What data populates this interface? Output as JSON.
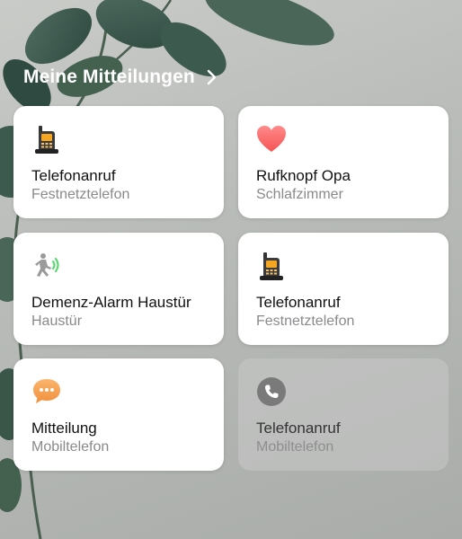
{
  "header": {
    "title": "Meine Mitteilungen"
  },
  "cards": [
    {
      "title": "Telefonanruf",
      "subtitle": "Festnetztelefon",
      "icon": "landline-phone-icon"
    },
    {
      "title": "Rufknopf Opa",
      "subtitle": "Schlafzimmer",
      "icon": "heart-icon"
    },
    {
      "title": "Demenz-Alarm Haustür",
      "subtitle": "Haustür",
      "icon": "running-person-alarm-icon"
    },
    {
      "title": "Telefonanruf",
      "subtitle": "Festnetztelefon",
      "icon": "landline-phone-icon"
    },
    {
      "title": "Mitteilung",
      "subtitle": "Mobiltelefon",
      "icon": "speech-bubble-icon"
    },
    {
      "title": "Telefonanruf",
      "subtitle": "Mobiltelefon",
      "icon": "phone-handset-icon"
    }
  ],
  "colors": {
    "heart": "#ff6b6b",
    "bubble": "#f5a25a",
    "alarm_waves": "#4cd964",
    "phone_circle": "#7a7a7a"
  }
}
